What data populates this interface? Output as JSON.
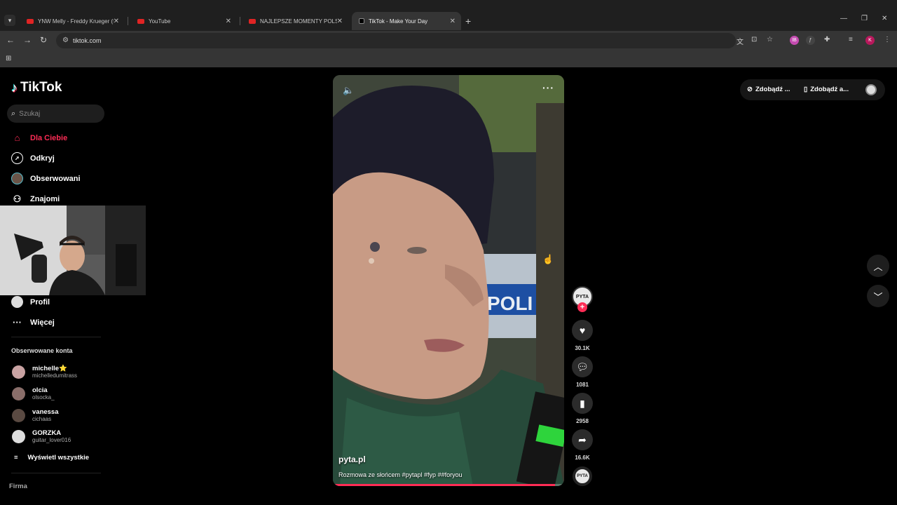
{
  "browser": {
    "tabs": [
      {
        "title": "YNW Melly - Freddy Krueger (ft",
        "active": false
      },
      {
        "title": "YouTube",
        "active": false
      },
      {
        "title": "NAJLEPSZE MOMENTY POLSKIE",
        "active": false
      },
      {
        "title": "TikTok - Make Your Day",
        "active": true
      }
    ],
    "url": "tiktok.com",
    "profile_initial": "K",
    "ext_initial": "IB"
  },
  "sidebar": {
    "brand": "TikTok",
    "search_placeholder": "Szukaj",
    "nav": [
      {
        "label": "Dla Ciebie",
        "icon": "home-icon"
      },
      {
        "label": "Odkryj",
        "icon": "compass-icon"
      },
      {
        "label": "Obserwowani",
        "icon": "following-avatar-icon"
      },
      {
        "label": "Znajomi",
        "icon": "friends-icon"
      },
      {
        "label": "Profil",
        "icon": "profile-avatar-icon"
      },
      {
        "label": "Więcej",
        "icon": "more-dots-icon"
      }
    ],
    "followed_title": "Obserwowane konta",
    "followed": [
      {
        "name": "michelle⭐",
        "handle": "michelledumitrass",
        "color": "#caa"
      },
      {
        "name": "olcia",
        "handle": "olsocka_",
        "color": "#8a6e6a"
      },
      {
        "name": "vanessa",
        "handle": "cichaas",
        "color": "#5a4a42"
      },
      {
        "name": "GORZKA",
        "handle": "guitar_lover016",
        "color": "#ddd"
      }
    ],
    "see_all": "Wyświetl wszystkie",
    "footer": "Firma"
  },
  "video": {
    "author": "pyta.pl",
    "caption": "Rozmowa ze słońcem #pytapl #fyp ##foryou",
    "progress": 0.96,
    "sign_text": "POLI"
  },
  "actions": {
    "avatar_text": "PYTA",
    "likes": "30.1K",
    "comments": "1081",
    "saves": "2958",
    "shares": "16.6K"
  },
  "top_right": {
    "item1": "Zdobądź ...",
    "item2": "Zdobądź a..."
  },
  "colors": {
    "accent": "#fe2c55"
  }
}
